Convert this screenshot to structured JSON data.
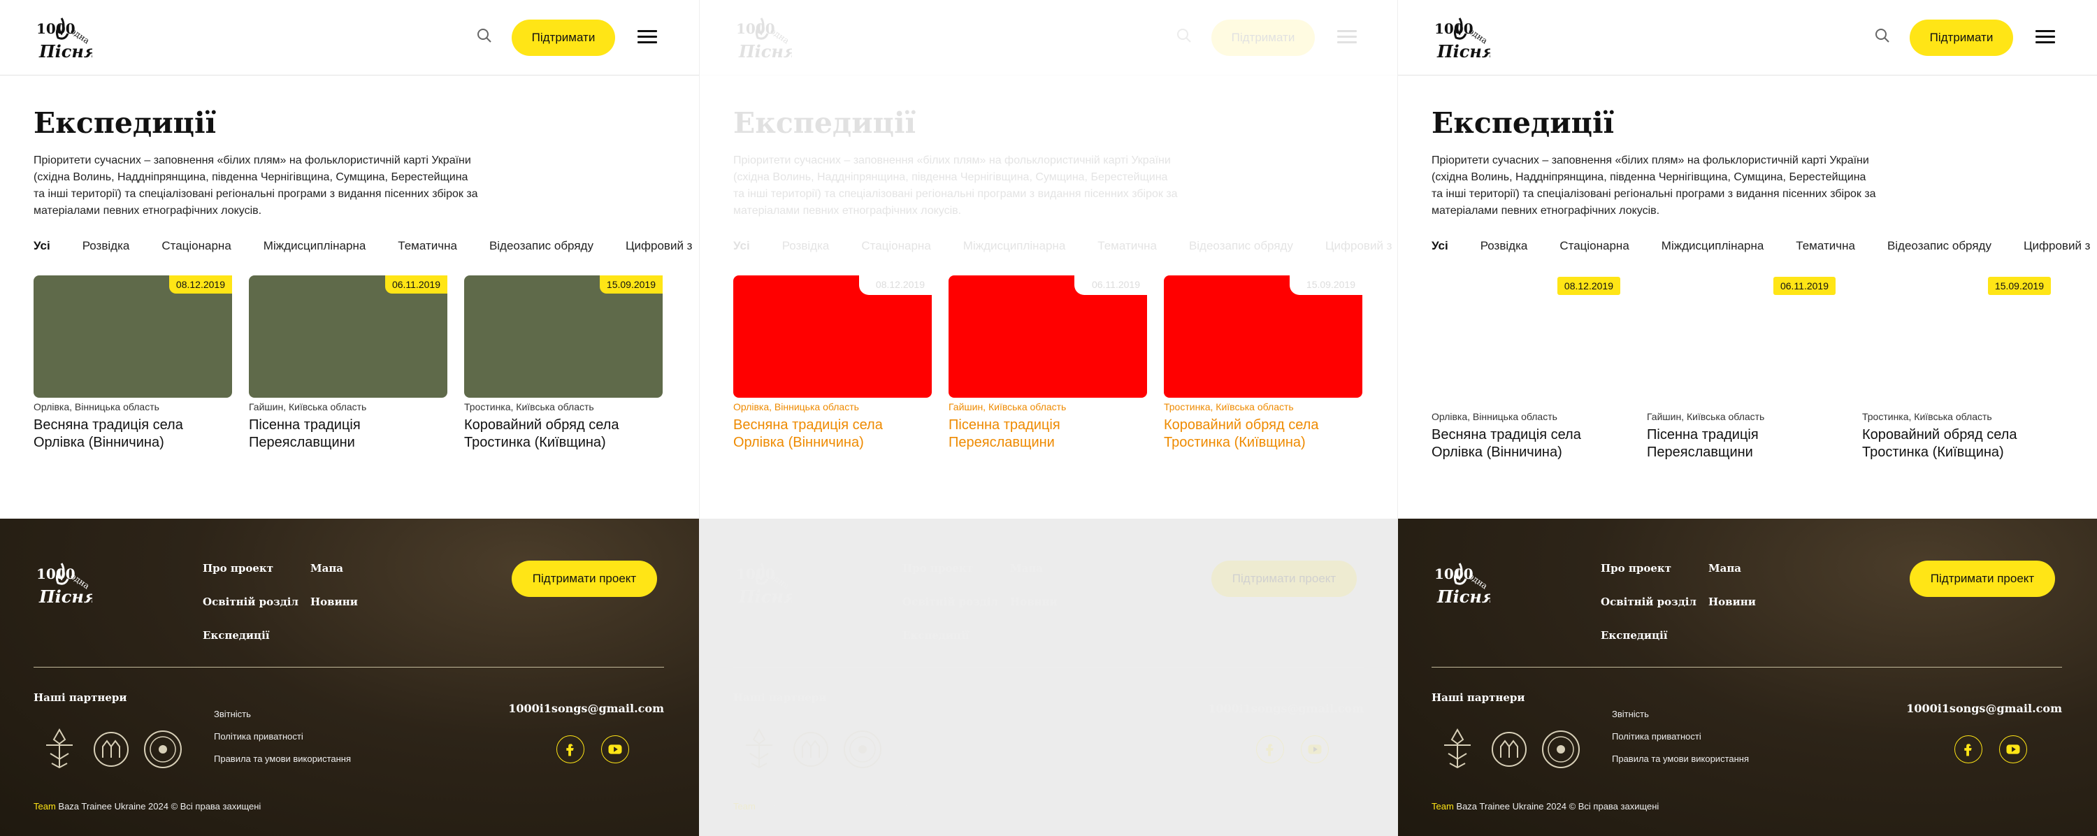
{
  "header": {
    "support_label": "Підтримати"
  },
  "page": {
    "title": "Експедиції",
    "description": "Пріоритети сучасних – заповнення «білих плям» на фольклористичній карті України (східна Волинь, Надднiпрянщина, південна Чернігівщина, Сумщина, Берестейщина та інші території) та спеціалізовані регіональні програми з видання пісенних збірок за матеріалами певних етнографічних локусів."
  },
  "filters": [
    "Усі",
    "Розвідка",
    "Стаціонарна",
    "Міждисциплінарна",
    "Тематична",
    "Відеозапис обряду",
    "Цифровий з"
  ],
  "cards": [
    {
      "date": "08.12.2019",
      "location": "Орлівка, Вінницька область",
      "title": "Весняна традиція села Орлівка (Вінничина)"
    },
    {
      "date": "06.11.2019",
      "location": "Гайшин, Київська область",
      "title": "Пісенна традиція Переяславщини"
    },
    {
      "date": "15.09.2019",
      "location": "Тростинка, Київська область",
      "title": "Коровайний обряд села Тростинка (Київщина)"
    }
  ],
  "footer": {
    "nav": [
      "Про проект",
      "Мапа",
      "Освітній розділ",
      "Новини",
      "Експедиції"
    ],
    "support_label": "Підтримати проект",
    "partners_title": "Наші партнери",
    "links": [
      "Звітність",
      "Політика приватності",
      "Правила та умови використання"
    ],
    "email": "1000i1songs@gmail.com",
    "copyright_team": "Team",
    "copyright_rest": " Baza Trainee Ukraine 2024 © Всі права захищені"
  },
  "colors": {
    "accent": "#ffe516",
    "footer_bg": "#2d2418",
    "debug_red": "#ff0000",
    "debug_orange": "#ee8a00"
  }
}
